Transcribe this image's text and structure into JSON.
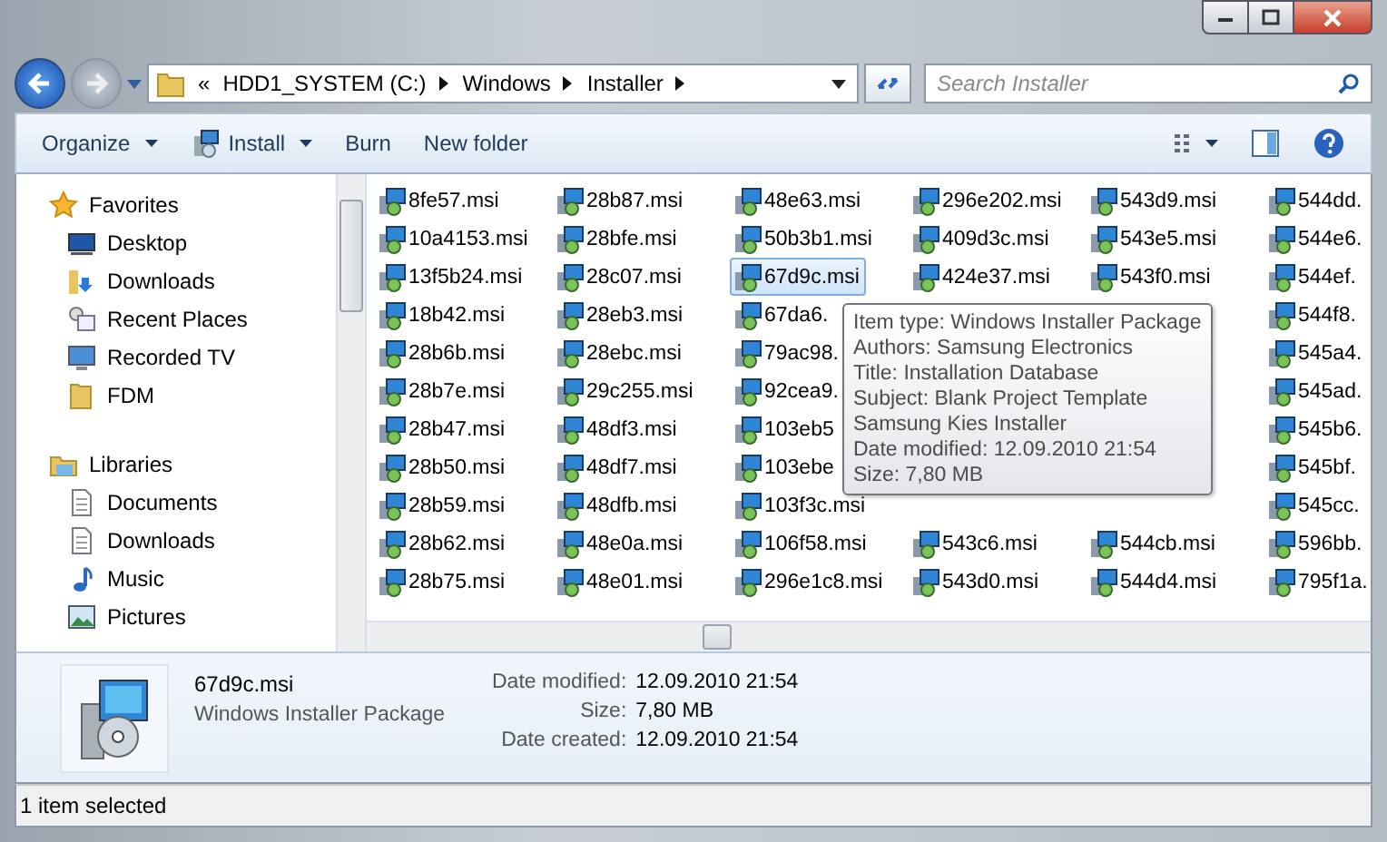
{
  "address": {
    "overflow": "«",
    "crumbs": [
      "HDD1_SYSTEM (C:)",
      "Windows",
      "Installer"
    ]
  },
  "search": {
    "placeholder": "Search Installer"
  },
  "toolbar": [
    {
      "label": "Organize",
      "kind": "menu"
    },
    {
      "label": "Install",
      "kind": "icon-menu"
    },
    {
      "label": "Burn",
      "kind": "plain"
    },
    {
      "label": "New folder",
      "kind": "plain"
    }
  ],
  "nav": [
    {
      "title": "Favorites",
      "kind": "favorites",
      "items": [
        {
          "label": "Desktop",
          "kind": "desktop"
        },
        {
          "label": "Downloads",
          "kind": "downloads"
        },
        {
          "label": "Recent Places",
          "kind": "recent"
        },
        {
          "label": "Recorded TV",
          "kind": "tv"
        },
        {
          "label": "FDM",
          "kind": "folder"
        }
      ]
    },
    {
      "title": "Libraries",
      "kind": "libraries",
      "items": [
        {
          "label": "Documents",
          "kind": "document"
        },
        {
          "label": "Downloads",
          "kind": "document"
        },
        {
          "label": "Music",
          "kind": "music"
        },
        {
          "label": "Pictures",
          "kind": "picture"
        }
      ]
    }
  ],
  "files": [
    [
      {
        "name": "8fe57.msi",
        "selected": false
      },
      {
        "name": "10a4153.msi",
        "selected": false
      },
      {
        "name": "13f5b24.msi",
        "selected": false
      },
      {
        "name": "18b42.msi",
        "selected": false
      },
      {
        "name": "28b6b.msi",
        "selected": false
      },
      {
        "name": "28b7e.msi",
        "selected": false
      },
      {
        "name": "28b47.msi",
        "selected": false
      },
      {
        "name": "28b50.msi",
        "selected": false
      },
      {
        "name": "28b59.msi",
        "selected": false
      },
      {
        "name": "28b62.msi",
        "selected": false
      },
      {
        "name": "28b75.msi",
        "selected": false
      }
    ],
    [
      {
        "name": "28b87.msi",
        "selected": false
      },
      {
        "name": "28bfe.msi",
        "selected": false
      },
      {
        "name": "28c07.msi",
        "selected": false
      },
      {
        "name": "28eb3.msi",
        "selected": false
      },
      {
        "name": "28ebc.msi",
        "selected": false
      },
      {
        "name": "29c255.msi",
        "selected": false
      },
      {
        "name": "48df3.msi",
        "selected": false
      },
      {
        "name": "48df7.msi",
        "selected": false
      },
      {
        "name": "48dfb.msi",
        "selected": false
      },
      {
        "name": "48e0a.msi",
        "selected": false
      },
      {
        "name": "48e01.msi",
        "selected": false
      }
    ],
    [
      {
        "name": "48e63.msi",
        "selected": false
      },
      {
        "name": "50b3b1.msi",
        "selected": false
      },
      {
        "name": "67d9c.msi",
        "selected": true
      },
      {
        "name": "67da6.",
        "selected": false
      },
      {
        "name": "79ac98.",
        "selected": false
      },
      {
        "name": "92cea9.",
        "selected": false
      },
      {
        "name": "103eb5",
        "selected": false
      },
      {
        "name": "103ebe",
        "selected": false
      },
      {
        "name": "103f3c.msi",
        "selected": false
      },
      {
        "name": "106f58.msi",
        "selected": false
      },
      {
        "name": "296e1c8.msi",
        "selected": false
      }
    ],
    [
      {
        "name": "296e202.msi",
        "selected": false
      },
      {
        "name": "409d3c.msi",
        "selected": false
      },
      {
        "name": "424e37.msi",
        "selected": false
      },
      {
        "name": "543c6.msi",
        "selected": false
      },
      {
        "name": "543d0.msi",
        "selected": false
      }
    ],
    [
      {
        "name": "543d9.msi",
        "selected": false
      },
      {
        "name": "543e5.msi",
        "selected": false
      },
      {
        "name": "543f0.msi",
        "selected": false
      },
      {
        "name": "544cb.msi",
        "selected": false
      },
      {
        "name": "544d4.msi",
        "selected": false
      }
    ],
    [
      {
        "name": "544dd.",
        "selected": false
      },
      {
        "name": "544e6.",
        "selected": false
      },
      {
        "name": "544ef.",
        "selected": false
      },
      {
        "name": "544f8.",
        "selected": false
      },
      {
        "name": "545a4.",
        "selected": false
      },
      {
        "name": "545ad.",
        "selected": false
      },
      {
        "name": "545b6.",
        "selected": false
      },
      {
        "name": "545bf.",
        "selected": false
      },
      {
        "name": "545cc.",
        "selected": false
      },
      {
        "name": "596bb.",
        "selected": false
      },
      {
        "name": "795f1a.",
        "selected": false
      }
    ]
  ],
  "tooltip": [
    "Item type: Windows Installer Package",
    "Authors: Samsung Electronics",
    "Title: Installation Database",
    "Subject: Blank Project Template",
    "Samsung Kies Installer",
    "Date modified: 12.09.2010 21:54",
    "Size: 7,80 MB"
  ],
  "details": {
    "name": "67d9c.msi",
    "type": "Windows Installer Package",
    "props": [
      {
        "label": "Date modified:",
        "value": "12.09.2010 21:54"
      },
      {
        "label": "Size:",
        "value": "7,80 MB"
      },
      {
        "label": "Date created:",
        "value": "12.09.2010 21:54"
      }
    ]
  },
  "status": "1 item selected"
}
